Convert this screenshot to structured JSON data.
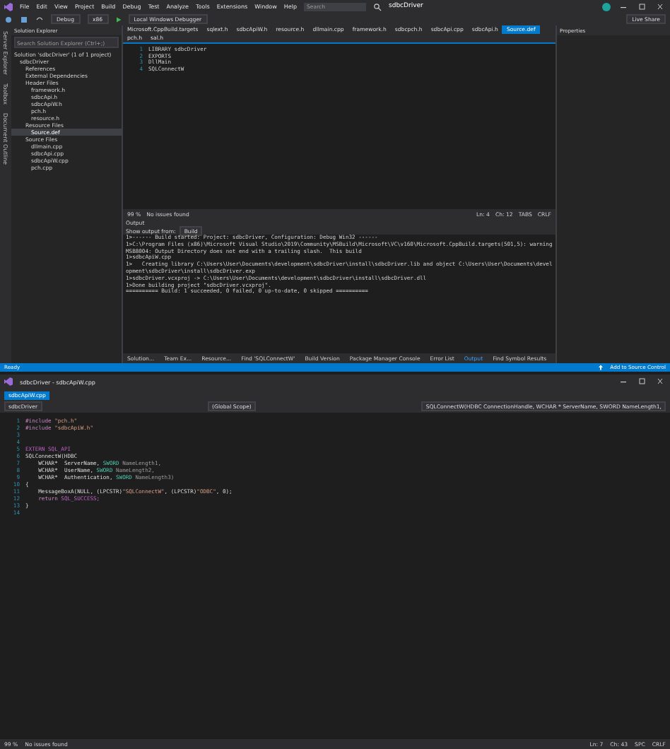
{
  "top_window": {
    "menu": [
      "File",
      "Edit",
      "View",
      "Project",
      "Build",
      "Debug",
      "Test",
      "Analyze",
      "Tools",
      "Extensions",
      "Window",
      "Help"
    ],
    "search": {
      "placeholder": "Search"
    },
    "title": "sdbcDriver",
    "toolbar": {
      "configuration": "Debug",
      "platform": "x86",
      "debugger": "Local Windows Debugger",
      "live_share": "Live Share"
    },
    "side_strip": [
      "Server Explorer",
      "Toolbox",
      "Document Outline"
    ],
    "solution_explorer": {
      "title": "Solution Explorer",
      "search": {
        "placeholder": "Search Solution Explorer (Ctrl+;)"
      },
      "tree": [
        {
          "label": "Solution 'sdbcDriver' (1 of 1 project)",
          "selected": false,
          "children": [
            {
              "label": "sdbcDriver",
              "selected": false,
              "children": [
                {
                  "label": "References",
                  "selected": false
                },
                {
                  "label": "External Dependencies",
                  "selected": false
                },
                {
                  "label": "Header Files",
                  "selected": false,
                  "children": [
                    {
                      "label": "framework.h",
                      "selected": false
                    },
                    {
                      "label": "sdbcApi.h",
                      "selected": false
                    },
                    {
                      "label": "sdbcApiW.h",
                      "selected": false
                    },
                    {
                      "label": "pch.h",
                      "selected": false
                    },
                    {
                      "label": "resource.h",
                      "selected": false
                    }
                  ]
                },
                {
                  "label": "Resource Files",
                  "selected": false,
                  "children": [
                    {
                      "label": "Source.def",
                      "selected": true
                    }
                  ]
                },
                {
                  "label": "Source Files",
                  "selected": false,
                  "children": [
                    {
                      "label": "dllmain.cpp",
                      "selected": false
                    },
                    {
                      "label": "sdbcApi.cpp",
                      "selected": false
                    },
                    {
                      "label": "sdbcApiW.cpp",
                      "selected": false
                    },
                    {
                      "label": "pch.cpp",
                      "selected": false
                    }
                  ]
                }
              ]
            }
          ]
        }
      ]
    },
    "editor_tabs": [
      {
        "label": "Microsoft.CppBuild.targets",
        "selected": false
      },
      {
        "label": "sqlext.h",
        "selected": false
      },
      {
        "label": "sdbcApiW.h",
        "selected": false
      },
      {
        "label": "resource.h",
        "selected": false
      },
      {
        "label": "dllmain.cpp",
        "selected": false
      },
      {
        "label": "framework.h",
        "selected": false
      },
      {
        "label": "sdbcpch.h",
        "selected": false
      },
      {
        "label": "sdbcApi.cpp",
        "selected": false
      },
      {
        "label": "sdbcApi.h",
        "selected": false
      },
      {
        "label": "Source.def",
        "selected": true
      },
      {
        "label": "pch.h",
        "selected": false
      },
      {
        "label": "sal.h",
        "selected": false
      }
    ],
    "code": [
      {
        "num": "1",
        "text": "LIBRARY sdbcDriver"
      },
      {
        "num": "2",
        "text": "EXPORTS"
      },
      {
        "num": "3",
        "text": "DllMain"
      },
      {
        "num": "4",
        "text": "SQLConnectW"
      }
    ],
    "editor_status": {
      "zoom": "99 %",
      "issues": "No issues found",
      "line": "Ln: 4",
      "col": "Ch: 12",
      "mode": "TABS",
      "eol": "CRLF"
    },
    "output": {
      "title": "Output",
      "source_label": "Show output from:",
      "source": "Build",
      "lines": [
        "1>------ Build started: Project: sdbcDriver, Configuration: Debug Win32 ------",
        "1>C:\\Program Files (x86)\\Microsoft Visual Studio\\2019\\Community\\MSBuild\\Microsoft\\VC\\v160\\Microsoft.CppBuild.targets(501,5): warning MSB8004: Output Directory does not end with a trailing slash.  This build",
        "1>sdbcApiW.cpp",
        "1>   Creating library C:\\Users\\User\\Documents\\development\\sdbcDriver\\install\\sdbcDriver.lib and object C:\\Users\\User\\Documents\\development\\sdbcDriver\\install\\sdbcDriver.exp",
        "1>sdbcDriver.vcxproj -> C:\\Users\\User\\Documents\\development\\sdbcDriver\\install\\sdbcDriver.dll",
        "1>Done building project \"sdbcDriver.vcxproj\".",
        "========== Build: 1 succeeded, 0 failed, 0 up-to-date, 0 skipped =========="
      ]
    },
    "bottom_tabs": [
      {
        "label": "Solution...",
        "selected": false
      },
      {
        "label": "Team Ex...",
        "selected": false
      },
      {
        "label": "Resource...",
        "selected": false
      },
      {
        "label": "Find 'SQLConnectW'",
        "selected": false
      },
      {
        "label": "Build Version",
        "selected": false
      },
      {
        "label": "Package Manager Console",
        "selected": false
      },
      {
        "label": "Error List",
        "selected": false
      },
      {
        "label": "Output",
        "selected": true
      },
      {
        "label": "Find Symbol Results",
        "selected": false
      }
    ],
    "properties": {
      "title": "Properties"
    },
    "status_bar": {
      "text": "Ready",
      "source_control": "Add to Source Control"
    }
  },
  "bottom_window": {
    "title": "sdbcDriver - sdbcApiW.cpp",
    "tabs": [
      {
        "label": "sdbcApiW.cpp",
        "selected": true
      }
    ],
    "nav": {
      "project": "sdbcDriver",
      "scope": "(Global Scope)",
      "member": "SQLConnectW(HDBC ConnectionHandle, WCHAR * ServerName, SWORD NameLength1,"
    },
    "code": [
      {
        "num": "1",
        "tokens": [
          {
            "kind": "keyword",
            "text": "#include "
          },
          {
            "kind": "string",
            "text": "\"pch.h\""
          }
        ]
      },
      {
        "num": "2",
        "tokens": [
          {
            "kind": "keyword",
            "text": "#include "
          },
          {
            "kind": "string",
            "text": "\"sdbcApiW.h\""
          }
        ]
      },
      {
        "num": "3"
      },
      {
        "num": "4"
      },
      {
        "num": "5",
        "tokens": [
          {
            "kind": "macro",
            "text": "EXTERN "
          },
          {
            "kind": "macro",
            "text": "SQL_API"
          }
        ]
      },
      {
        "num": "6",
        "tokens": [
          {
            "kind": "plain",
            "text": "SQLConnectW(HDBC"
          }
        ]
      },
      {
        "num": "7",
        "tokens": [
          {
            "kind": "plain",
            "text": "    WCHAR*  "
          },
          {
            "kind": "plain",
            "text": "ServerName, "
          },
          {
            "kind": "type",
            "text": "SWORD "
          },
          {
            "kind": "param",
            "text": "NameLength1,"
          }
        ]
      },
      {
        "num": "8",
        "tokens": [
          {
            "kind": "plain",
            "text": "    WCHAR*  "
          },
          {
            "kind": "plain",
            "text": "UserName, "
          },
          {
            "kind": "type",
            "text": "SWORD "
          },
          {
            "kind": "param",
            "text": "NameLength2,"
          }
        ]
      },
      {
        "num": "9",
        "tokens": [
          {
            "kind": "plain",
            "text": "    WCHAR*  "
          },
          {
            "kind": "plain",
            "text": "Authentication, "
          },
          {
            "kind": "type",
            "text": "SWORD "
          },
          {
            "kind": "param",
            "text": "NameLength3)"
          }
        ]
      },
      {
        "num": "10",
        "tokens": [
          {
            "kind": "plain",
            "text": "{"
          }
        ]
      },
      {
        "num": "11",
        "tokens": [
          {
            "kind": "plain",
            "text": "    MessageBoxA(NULL, (LPCSTR)"
          },
          {
            "kind": "string",
            "text": "\"SQLConnectW\""
          },
          {
            "kind": "plain",
            "text": ", (LPCSTR)"
          },
          {
            "kind": "string",
            "text": "\"ODBC\""
          },
          {
            "kind": "plain",
            "text": ", 0);"
          }
        ]
      },
      {
        "num": "12",
        "tokens": [
          {
            "kind": "keyword",
            "text": "    return "
          },
          {
            "kind": "macro",
            "text": "SQL_SUCCESS;"
          }
        ]
      },
      {
        "num": "13",
        "tokens": [
          {
            "kind": "plain",
            "text": "}"
          }
        ]
      },
      {
        "num": "14"
      }
    ],
    "status": {
      "zoom": "99 %",
      "issues": "No issues found",
      "line": "Ln: 7",
      "col": "Ch: 43",
      "mode": "SPC",
      "eol": "CRLF"
    }
  }
}
